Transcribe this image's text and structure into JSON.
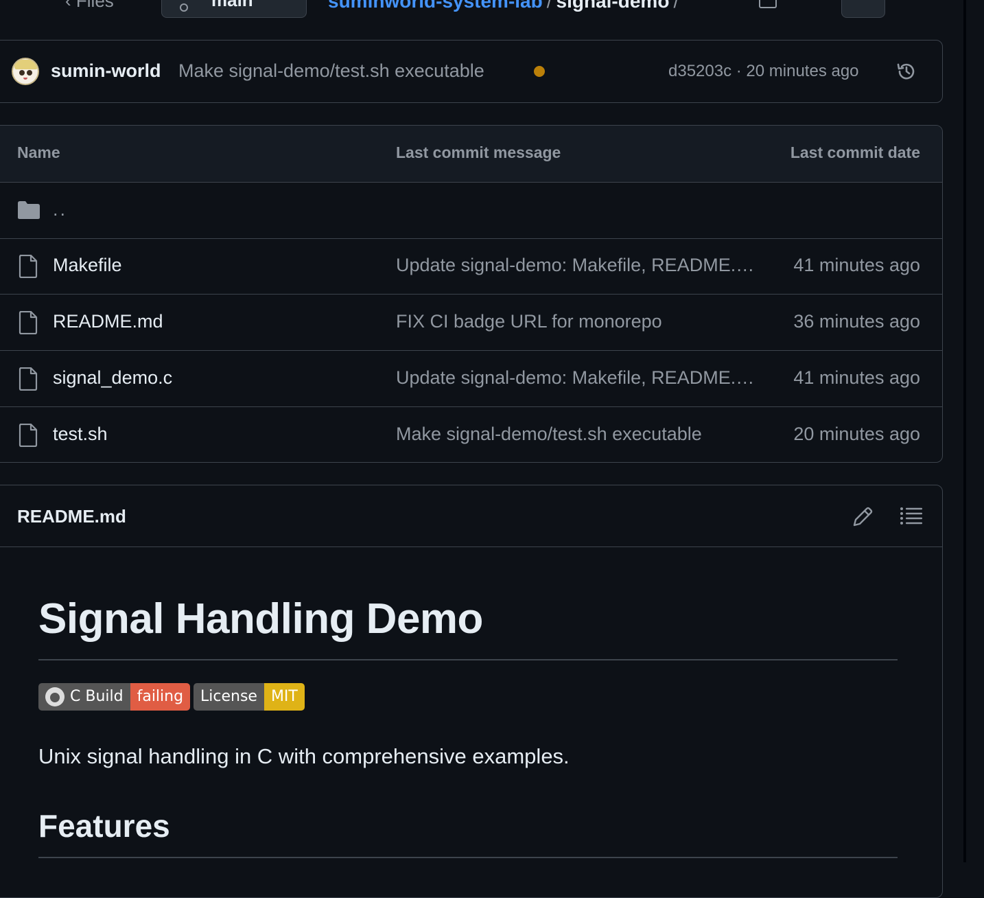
{
  "topbar": {
    "files_label": "Files",
    "branch_label": "main",
    "repo_crumb": "suminworld-system-lab",
    "separator": "/",
    "dir_crumb": "signal-demo"
  },
  "commit": {
    "author": "sumin-world",
    "message": "Make signal-demo/test.sh executable",
    "status_color": "#bb8009",
    "meta": "d35203c · 20 minutes ago"
  },
  "table": {
    "headers": {
      "name": "Name",
      "message": "Last commit message",
      "date": "Last commit date"
    },
    "parent_dir": "..",
    "rows": [
      {
        "name": "Makefile",
        "message": "Update signal-demo: Makefile, README.md, and signal_demo.c",
        "date": "41 minutes ago"
      },
      {
        "name": "README.md",
        "message": "FIX CI badge URL for monorepo",
        "date": "36 minutes ago"
      },
      {
        "name": "signal_demo.c",
        "message": "Update signal-demo: Makefile, README.md, and signal_demo.c",
        "date": "41 minutes ago"
      },
      {
        "name": "test.sh",
        "message": "Make signal-demo/test.sh executable",
        "date": "20 minutes ago"
      }
    ]
  },
  "readme": {
    "title": "README.md",
    "h1": "Signal Handling Demo",
    "badges": [
      {
        "label": "C Build",
        "value": "failing",
        "color": "#e05d44"
      },
      {
        "label": "License",
        "value": "MIT",
        "color": "#dfb317"
      }
    ],
    "paragraph": "Unix signal handling in C with comprehensive examples.",
    "h2": "Features"
  },
  "colors": {
    "background": "#0d1117",
    "border": "#3d444d",
    "muted": "#9198a1",
    "link": "#4493f8"
  }
}
